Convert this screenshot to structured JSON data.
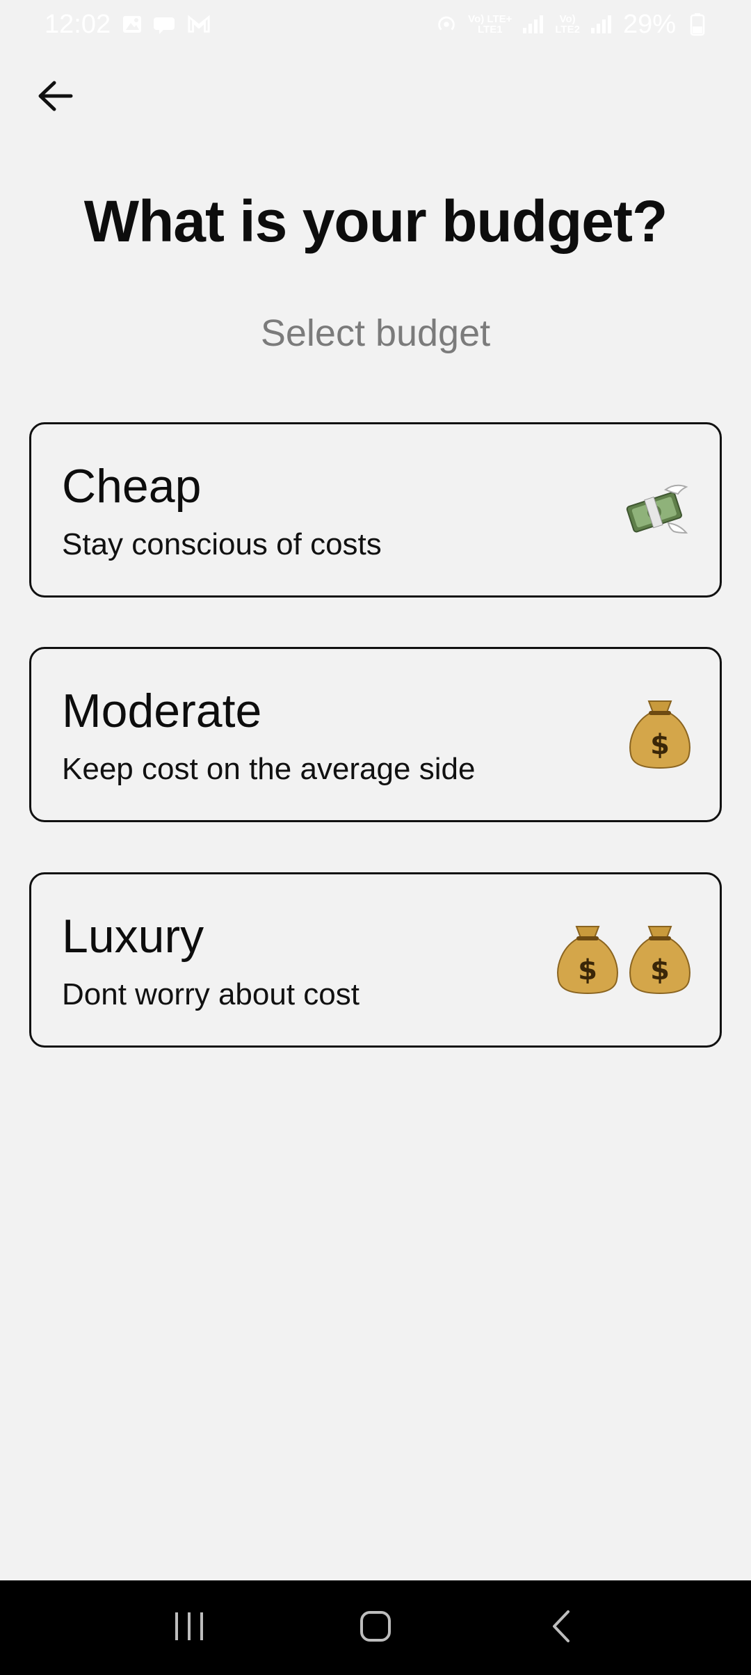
{
  "status_bar": {
    "time": "12:02",
    "battery": "29%",
    "net1": "Vo) LTE+\nLTE1",
    "net2": "Vo)\nLTE2"
  },
  "header": {
    "title": "What is your budget?",
    "subtitle": "Select budget"
  },
  "options": [
    {
      "title": "Cheap",
      "description": "Stay conscious of costs",
      "icon": "money-with-wings-icon"
    },
    {
      "title": "Moderate",
      "description": "Keep cost on the average side",
      "icon": "money-bag-icon"
    },
    {
      "title": "Luxury",
      "description": "Dont worry about cost",
      "icon": "money-bag-icon"
    }
  ],
  "colors": {
    "background": "#f2f2f2",
    "text": "#111111",
    "subtitle": "#7b7b7b",
    "nav_bar": "#000000",
    "bag": "#c99a3c",
    "bill": "#6f8f5a"
  }
}
